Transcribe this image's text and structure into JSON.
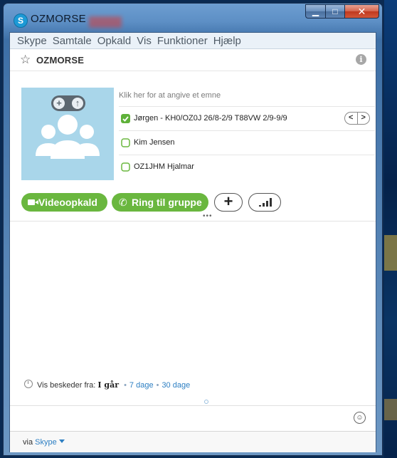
{
  "window": {
    "title": "OZMORSE",
    "min_label": "▁",
    "max_label": "□",
    "close_label": "✕"
  },
  "menu": [
    "Skype",
    "Samtale",
    "Opkald",
    "Vis",
    "Funktioner",
    "Hjælp"
  ],
  "header": {
    "group_name": "OZMORSE",
    "info_label": "i"
  },
  "conversation": {
    "topic_placeholder": "Klik her for at angive et emne",
    "participants": [
      {
        "name": "Jørgen - KH0/OZ0J 26/8-2/9 T88VW 2/9-9/9",
        "status": "online"
      },
      {
        "name": "Kim Jensen",
        "status": "offline"
      },
      {
        "name": "OZ1JHM Hjalmar",
        "status": "offline"
      }
    ],
    "pager_prev": "<",
    "pager_next": ">"
  },
  "actions": {
    "video_label": "Videoopkald",
    "call_label": "Ring til gruppe",
    "add_label": "+"
  },
  "history": {
    "prefix": "Vis beskeder fra:",
    "selected": "I går",
    "option_7": "7 dage",
    "option_30": "30 dage",
    "separator": "•"
  },
  "footer": {
    "via": "via",
    "service": "Skype"
  },
  "colors": {
    "accent_green": "#6ab73f",
    "online_green": "#5fb13a",
    "link_blue": "#2d7fc3",
    "avatar_bg": "#a9d6ea"
  },
  "icons": {
    "app": "skype-icon",
    "star": "star-outline-icon",
    "info": "info-icon",
    "video": "video-camera-icon",
    "phone": "phone-icon",
    "quality": "signal-bars-icon",
    "emoji": "smiley-icon",
    "clock": "clock-icon"
  }
}
